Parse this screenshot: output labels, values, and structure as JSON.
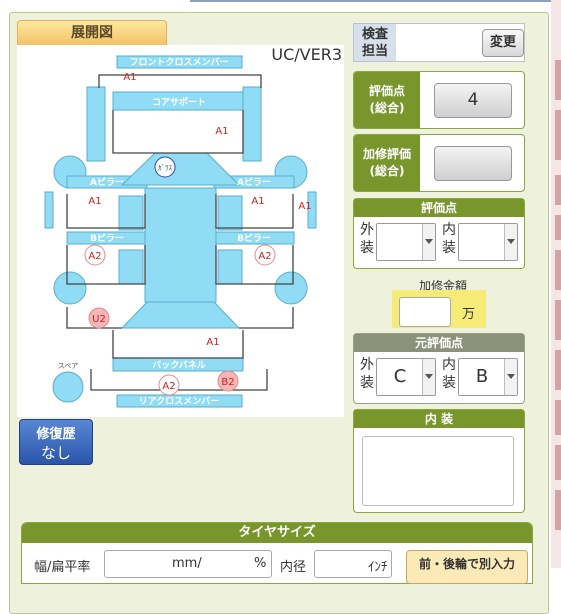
{
  "diagram": {
    "tab_label": "展開図",
    "version": "UC/VER3",
    "parts": {
      "front_cross_member": "フロントクロスメンバー",
      "core_support": "コアサポート",
      "a_pillar_left": "Aピラー",
      "a_pillar_right": "Aピラー",
      "b_pillar_left": "Bピラー",
      "b_pillar_right": "Bピラー",
      "back_panel": "バックパネル",
      "rear_cross_member": "リアクロスメンバー",
      "spare": "スペア",
      "glass": "ｶﾞﾗｽ"
    },
    "marks": {
      "m1": "A1",
      "m2": "A1",
      "m3": "A1",
      "m4": "A1",
      "m5": "A1",
      "m6": "A1",
      "m7": "A2",
      "m8": "A2",
      "m9": "U2",
      "m10": "A2",
      "m11": "B2"
    }
  },
  "repair_history": {
    "title": "修復歴",
    "value": "なし"
  },
  "inspector": {
    "label": "検査担当",
    "label_line1": "検査",
    "label_line2": "担当",
    "change_button": "変更"
  },
  "score_total": {
    "label_line1": "評価点",
    "label_line2": "(総合)",
    "value": "4"
  },
  "repair_score": {
    "label_line1": "加修評価",
    "label_line2": "(総合)",
    "value": ""
  },
  "grade": {
    "title": "評価点",
    "ext_label_1": "外",
    "ext_label_2": "装",
    "int_label_1": "内",
    "int_label_2": "装",
    "ext_value": "",
    "int_value": ""
  },
  "repair_amount": {
    "label": "加修金額",
    "unit": "万",
    "value": ""
  },
  "original_grade": {
    "title": "元評価点",
    "ext_label_1": "外",
    "ext_label_2": "装",
    "int_label_1": "内",
    "int_label_2": "装",
    "ext_value": "C",
    "int_value": "B"
  },
  "interior": {
    "title": "内 装",
    "value": ""
  },
  "tire": {
    "title": "タイヤサイズ",
    "width_ratio_label": "幅/扁平率",
    "mm_unit": "mm/",
    "pct_unit": "%",
    "diameter_label": "内径",
    "inch_unit": "ｲﾝﾁ",
    "front_rear_button": "前・後輪で別入力"
  },
  "colors": {
    "accent_green": "#78962c",
    "part_blue": "#8fdcf4",
    "mark_red": "#d22020"
  }
}
